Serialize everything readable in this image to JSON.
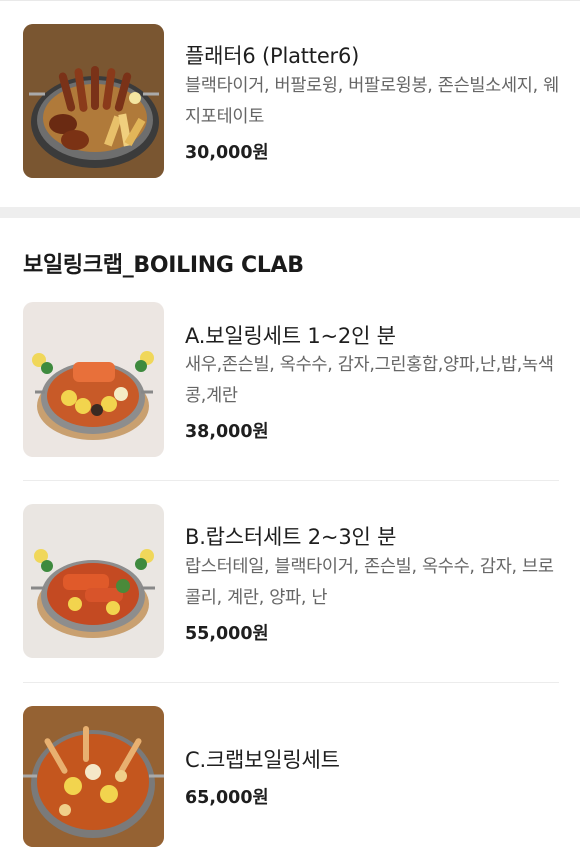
{
  "items_top": [
    {
      "name": "플래터6 (Platter6)",
      "desc": "블랙타이거, 버팔로윙, 버팔로윙봉, 존슨빌소세지, 웨지포테이토",
      "price": "30,000원"
    }
  ],
  "section": {
    "title": "보일링크랩_BOILING CLAB",
    "items": [
      {
        "name": "A.보일링세트 1~2인 분",
        "desc": "새우,존슨빌, 옥수수, 감자,그린홍합,양파,난,밥,녹색콩,계란",
        "price": "38,000원"
      },
      {
        "name": "B.랍스터세트 2~3인 분",
        "desc": "랍스터테일, 블랙타이거, 존슨빌, 옥수수, 감자, 브로콜리, 계란, 양파, 난",
        "price": "55,000원"
      },
      {
        "name": "C.크랩보일링세트",
        "desc": "",
        "price": "65,000원"
      }
    ]
  }
}
